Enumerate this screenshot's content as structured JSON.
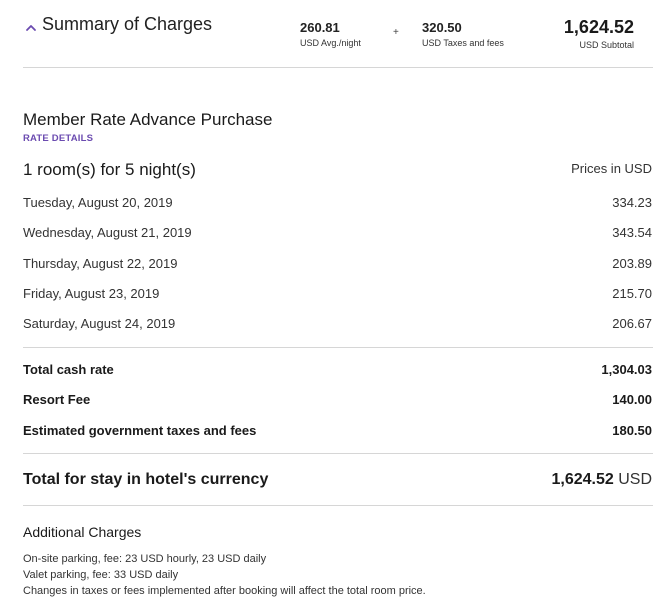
{
  "summary": {
    "title": "Summary of Charges",
    "avg_night_value": "260.81",
    "avg_night_label": "USD Avg./night",
    "plus_symbol": "+",
    "taxes_value": "320.50",
    "taxes_label": "USD Taxes and fees",
    "subtotal_value": "1,624.52",
    "subtotal_label": "USD Subtotal",
    "toggle_icon": "chevron-up-icon",
    "accent_color": "#6b4bb0"
  },
  "rate": {
    "name": "Member Rate Advance Purchase",
    "details_link": "RATE DETAILS",
    "rooms_nights": "1 room(s) for 5 night(s)",
    "prices_in": "Prices in USD"
  },
  "nights": [
    {
      "date": "Tuesday, August 20, 2019",
      "price": "334.23"
    },
    {
      "date": "Wednesday, August 21, 2019",
      "price": "343.54"
    },
    {
      "date": "Thursday, August 22, 2019",
      "price": "203.89"
    },
    {
      "date": "Friday, August 23, 2019",
      "price": "215.70"
    },
    {
      "date": "Saturday, August 24, 2019",
      "price": "206.67"
    }
  ],
  "fees": [
    {
      "label": "Total cash rate",
      "value": "1,304.03"
    },
    {
      "label": "Resort Fee",
      "value": "140.00"
    },
    {
      "label": "Estimated government taxes and fees",
      "value": "180.50"
    }
  ],
  "total": {
    "label": "Total for stay in hotel's currency",
    "value": "1,624.52",
    "currency": "USD"
  },
  "additional": {
    "title": "Additional Charges",
    "lines": [
      "On-site parking, fee: 23 USD hourly, 23 USD daily",
      "Valet parking, fee: 33 USD daily",
      "Changes in taxes or fees implemented after booking will affect the total room price."
    ]
  }
}
